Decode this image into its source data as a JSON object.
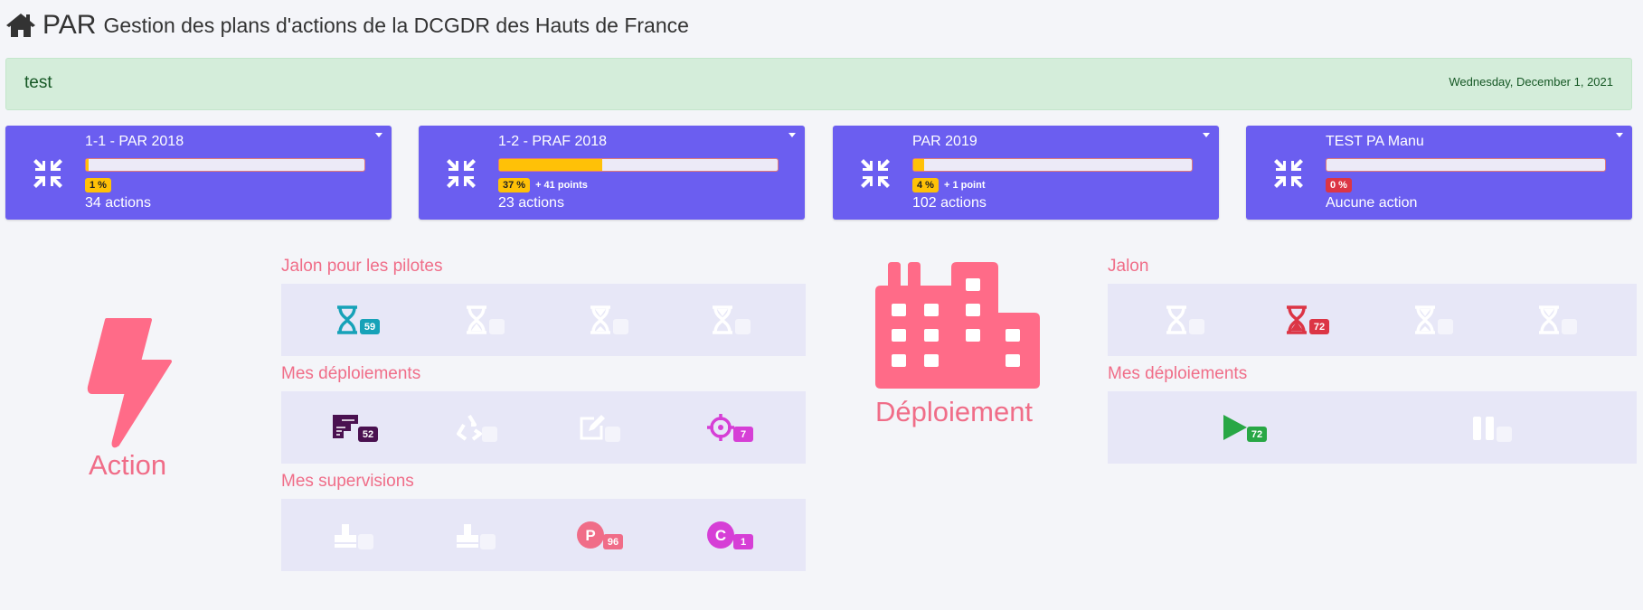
{
  "header": {
    "app_name": "PAR",
    "subtitle": "Gestion des plans d'actions de la DCGDR des Hauts de France"
  },
  "alert": {
    "message": "test",
    "date": "Wednesday, December 1, 2021"
  },
  "plans": [
    {
      "title": "1-1 - PAR 2018",
      "progress": 1,
      "percent_label": "1 %",
      "points": "",
      "actions": "34 actions",
      "badge_color": "yellow"
    },
    {
      "title": "1-2 - PRAF 2018",
      "progress": 37,
      "percent_label": "37 %",
      "points": "+ 41 points",
      "actions": "23 actions",
      "badge_color": "yellow"
    },
    {
      "title": "PAR 2019",
      "progress": 4,
      "percent_label": "4 %",
      "points": "+ 1 point",
      "actions": "102 actions",
      "badge_color": "yellow"
    },
    {
      "title": "TEST PA Manu",
      "progress": 0,
      "percent_label": "0 %",
      "points": "",
      "actions": "Aucune action",
      "badge_color": "red"
    }
  ],
  "action_section": {
    "label": "Action",
    "jalon_pilotes": {
      "title": "Jalon pour les pilotes",
      "items": [
        {
          "icon": "hourglass-icon",
          "count": "59",
          "color": "#17a2b8"
        },
        {
          "icon": "hourglass-icon",
          "count": "",
          "color": "#ffffff"
        },
        {
          "icon": "hourglass-icon",
          "count": "",
          "color": "#ffffff"
        },
        {
          "icon": "hourglass-icon",
          "count": "",
          "color": "#ffffff"
        }
      ]
    },
    "mes_deploiements": {
      "title": "Mes déploiements",
      "items": [
        {
          "icon": "stairs-icon",
          "count": "52",
          "color": "#4a1150"
        },
        {
          "icon": "recycle-icon",
          "count": "",
          "color": "#ffffff"
        },
        {
          "icon": "edit-icon",
          "count": "",
          "color": "#ffffff"
        },
        {
          "icon": "crosshairs-icon",
          "count": "7",
          "color": "#d63fd6"
        }
      ]
    },
    "mes_supervisions": {
      "title": "Mes supervisions",
      "items": [
        {
          "icon": "stamp-icon",
          "count": "",
          "color": "#ffffff"
        },
        {
          "icon": "stamp-icon",
          "count": "",
          "color": "#ffffff"
        },
        {
          "icon": "p-circle-icon",
          "count": "96",
          "color": "#f06d88"
        },
        {
          "icon": "c-circle-icon",
          "count": "1",
          "color": "#d63fd6"
        }
      ]
    }
  },
  "deploiement_section": {
    "label": "Déploiement",
    "jalon": {
      "title": "Jalon",
      "items": [
        {
          "icon": "hourglass-icon",
          "count": "",
          "color": "#ffffff"
        },
        {
          "icon": "hourglass-icon",
          "count": "72",
          "color": "#dc3545"
        },
        {
          "icon": "hourglass-icon",
          "count": "",
          "color": "#ffffff"
        },
        {
          "icon": "hourglass-icon",
          "count": "",
          "color": "#ffffff"
        }
      ]
    },
    "mes_deploiements": {
      "title": "Mes déploiements",
      "items": [
        {
          "icon": "play-icon",
          "count": "72",
          "color": "#28a745"
        },
        {
          "icon": "pause-icon",
          "count": "",
          "color": "#ffffff"
        }
      ]
    }
  }
}
